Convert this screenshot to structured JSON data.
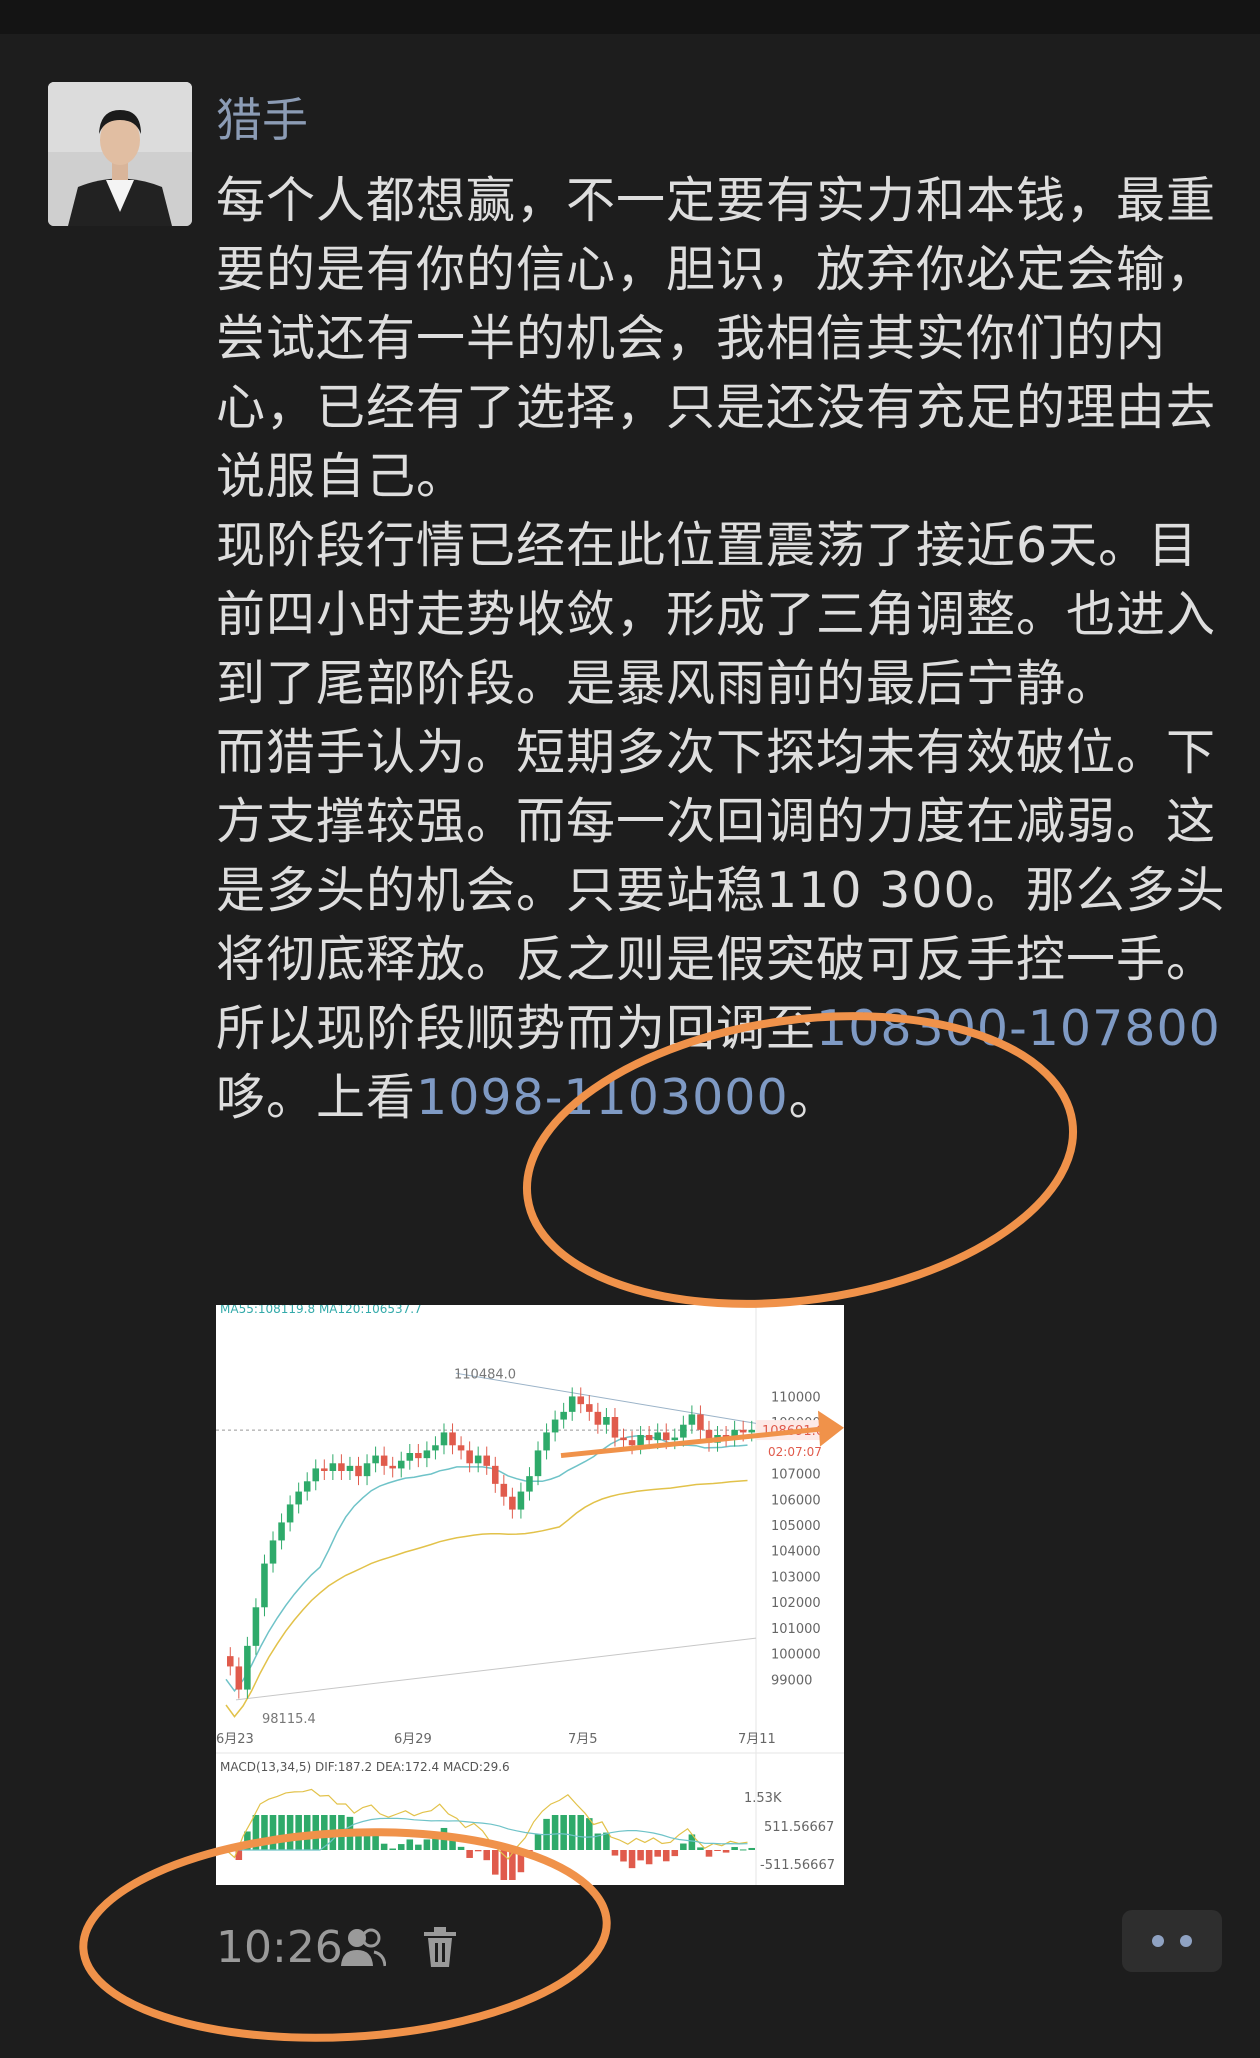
{
  "contact": {
    "name": "猎手",
    "avatar_icon": "profile-photo"
  },
  "post": {
    "p1": "每个人都想赢，不一定要有实力和本钱，最重要的是有你的信心，胆识，放弃你必定会输，尝试还有一半的机会，我相信其实你们的内心，已经有了选择，只是还没有充足的理由去说服自己。",
    "p2": "现阶段行情已经在此位置震荡了接近6天。目前四小时走势收敛，形成了三角调整。也进入到了尾部阶段。是暴风雨前的最后宁静。",
    "p3a": "而猎手认为。短期多次下探均未有效破位。下方支撑较强。而每一次回调的力度在减弱。这是多头的机会。只要站稳110 300。那么多头将彻底释放。反之则是假突破可反手控一手。所以现阶段顺势而为回调至",
    "p3_link1": "108300-107800",
    "p3b": "哆。上看",
    "p3_link2": "1098-1103000",
    "p3c": "。"
  },
  "chart_data": {
    "type": "candlestick",
    "indicator_header": "MA55:108119.8  MA120:106537.7",
    "y_ticks": [
      "110000",
      "109000",
      "108000",
      "107000",
      "106000",
      "105000",
      "104000",
      "103000",
      "102000",
      "101000",
      "100000",
      "99000"
    ],
    "current_price": "108691.6",
    "countdown": "02:07:07",
    "high_label": "110484.0",
    "low_label": "98115.4",
    "x_ticks": [
      "6月23",
      "6月29",
      "7月5",
      "7月11"
    ],
    "close": [
      99500,
      98600,
      100300,
      101800,
      103500,
      104400,
      105100,
      105800,
      106300,
      106700,
      107200,
      107100,
      107400,
      107100,
      107300,
      106900,
      107400,
      107700,
      107300,
      107200,
      107500,
      107800,
      107600,
      107900,
      108100,
      108600,
      108100,
      107900,
      107400,
      107700,
      107300,
      106600,
      106100,
      105600,
      106300,
      106900,
      107900,
      108600,
      109100,
      109400,
      110000,
      109700,
      109400,
      108900,
      109200,
      108400,
      108300,
      108100,
      108500,
      108300,
      108600,
      108300,
      108400,
      108900,
      109300,
      108700,
      108200,
      108500,
      108400,
      108700,
      108600,
      108700
    ],
    "macd_header": "MACD(13,34,5)  DIF:187.2  DEA:172.4  MACD:29.6",
    "macd_ticks": [
      "1.53K",
      "511.56667",
      "-511.56667"
    ]
  },
  "footer": {
    "time": "10:26",
    "visibility_icon": "friends-visible-icon",
    "delete_icon": "trash-icon",
    "more_icon": "more-dots-icon"
  },
  "annotation_color": "#f0924a"
}
